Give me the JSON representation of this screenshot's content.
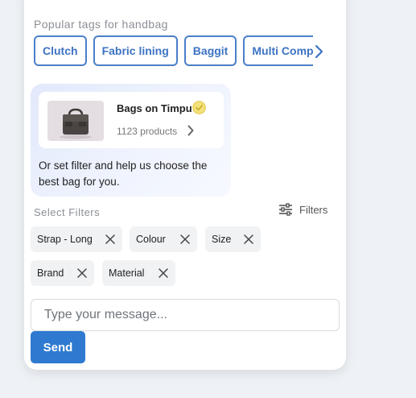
{
  "tags": {
    "title": "Popular tags for handbag",
    "items": [
      "Clutch",
      "Fabric lining",
      "Baggit",
      "Multi Compartment"
    ]
  },
  "store": {
    "name": "Bags on Timpu",
    "products": "1123 products",
    "verified_color": "#e8cf4a"
  },
  "bubble": {
    "text": "Or set filter and help us choose the best bag for you."
  },
  "filters": {
    "label": "Select Filters",
    "button_label": "Filters",
    "chips": [
      "Strap - Long",
      "Colour",
      "Size",
      "Brand",
      "Material"
    ]
  },
  "composer": {
    "placeholder": "Type your message...",
    "send_label": "Send"
  },
  "colors": {
    "accent": "#2f7ad0",
    "tag_border": "#4a7fc9"
  }
}
